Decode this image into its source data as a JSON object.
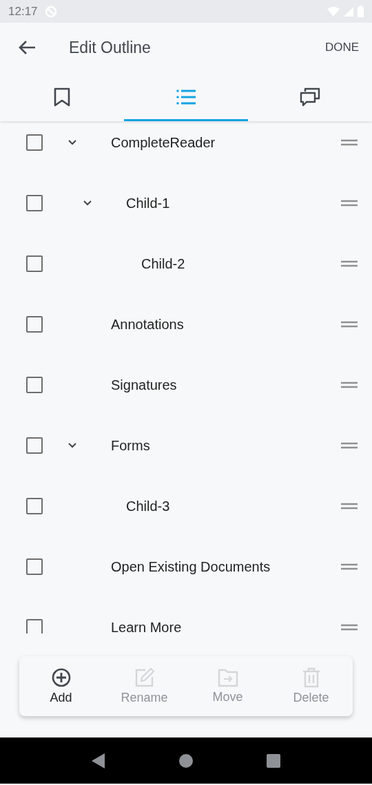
{
  "status_bar": {
    "time": "12:17"
  },
  "app_bar": {
    "title": "Edit Outline",
    "action": "DONE"
  },
  "tabs": [
    {
      "kind": "bookmark",
      "selected": false
    },
    {
      "kind": "outline",
      "selected": true
    },
    {
      "kind": "comments",
      "selected": false
    }
  ],
  "outline": [
    {
      "label": "CompleteReader",
      "checked": false,
      "expanded": true,
      "children": [
        {
          "label": "Child-1",
          "checked": false,
          "expanded": true,
          "children": [
            {
              "label": "Child-2",
              "checked": false
            }
          ]
        }
      ]
    },
    {
      "label": "Annotations",
      "checked": false
    },
    {
      "label": "Signatures",
      "checked": false
    },
    {
      "label": "Forms",
      "checked": false,
      "expanded": true,
      "children": [
        {
          "label": "Child-3",
          "checked": false
        }
      ]
    },
    {
      "label": "Open Existing Documents",
      "checked": false
    },
    {
      "label": "Learn More",
      "checked": false
    }
  ],
  "toolbar": [
    {
      "kind": "add",
      "label": "Add",
      "disabled": false
    },
    {
      "kind": "rename",
      "label": "Rename",
      "disabled": true
    },
    {
      "kind": "move",
      "label": "Move",
      "disabled": true
    },
    {
      "kind": "delete",
      "label": "Delete",
      "disabled": true
    }
  ]
}
